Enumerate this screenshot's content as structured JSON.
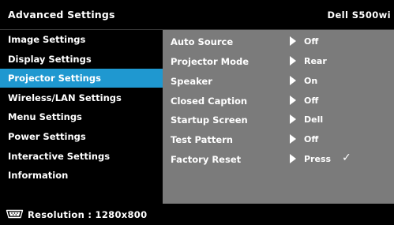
{
  "header": {
    "title": "Advanced Settings",
    "model": "Dell S500wi"
  },
  "sidebar": {
    "items": [
      {
        "label": "Image Settings"
      },
      {
        "label": "Display Settings"
      },
      {
        "label": "Projector Settings",
        "selected": true
      },
      {
        "label": "Wireless/LAN Settings"
      },
      {
        "label": "Menu Settings"
      },
      {
        "label": "Power Settings"
      },
      {
        "label": "Interactive Settings"
      },
      {
        "label": "Information"
      }
    ]
  },
  "settings": {
    "rows": [
      {
        "label": "Auto Source",
        "value": "Off"
      },
      {
        "label": "Projector Mode",
        "value": "Rear"
      },
      {
        "label": "Speaker",
        "value": "On"
      },
      {
        "label": "Closed Caption",
        "value": "Off"
      },
      {
        "label": "Startup Screen",
        "value": "Dell"
      },
      {
        "label": "Test Pattern",
        "value": "Off"
      },
      {
        "label": "Factory Reset",
        "value": "Press",
        "check": "✓"
      }
    ]
  },
  "footer": {
    "input_icon": "vga-connector-icon",
    "resolution": "Resolution : 1280x800"
  },
  "colors": {
    "background": "#000000",
    "selected": "#1f98d0",
    "panel": "#7b7b7b",
    "text": "#ffffff"
  }
}
